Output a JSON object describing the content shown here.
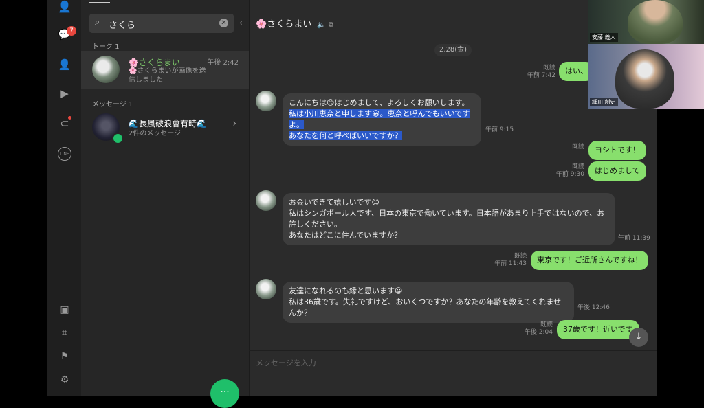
{
  "rail": {
    "badge": "7"
  },
  "search": {
    "query": "さくら"
  },
  "sections": {
    "talk": "トーク 1",
    "message": "メッセージ 1"
  },
  "talk_row": {
    "name": "さくらまい",
    "time": "午後 2:42",
    "preview": "さくらまいが画像を送信しました"
  },
  "msg_row": {
    "name": "長風破浪會有時",
    "preview": "2件のメッセージ"
  },
  "chat": {
    "title": "さくらまい",
    "date": "2.28(金)",
    "input_placeholder": "メッセージを入力",
    "read": "既読"
  },
  "messages": {
    "m1": {
      "text": "はい、",
      "time": "午前 7:42"
    },
    "m2": {
      "line1": "こんにちは😊はじめまして、よろしくお願いします。",
      "line2": "私は小川恵奈と申します😀。恵奈と呼んでもいいですよ。",
      "line3": "あなたを何と呼べばいいですか？",
      "time": "午前 9:15"
    },
    "m3": {
      "text": "ヨシトです！"
    },
    "m4": {
      "text": "はじめまして",
      "time": "午前 9:30"
    },
    "m5": {
      "line1": "お会いできて嬉しいです😊",
      "line2": "私はシンガポール人です、日本の東京で働いています。日本語があまり上手ではないので、お許しください。",
      "line3": "あなたはどこに住んでいますか？",
      "time": "午前 11:39"
    },
    "m6": {
      "text": "東京です！ご近所さんですね！",
      "time": "午前 11:43"
    },
    "m7": {
      "line1": "友達になれるのも縁と思います😀",
      "line2": "私は36歳です。失礼ですけど、おいくつですか？あなたの年齢を教えてくれませんか？",
      "time": "午後 12:46"
    },
    "m8": {
      "text": "37歳です！近いです",
      "time": "午後 2:04"
    }
  },
  "video": {
    "person1": "安藤 義人",
    "person2": "細川 創史"
  },
  "colors": {
    "accent": "#1fbf6a",
    "bubble_out": "#88df6d",
    "highlight": "#2b59c9"
  }
}
